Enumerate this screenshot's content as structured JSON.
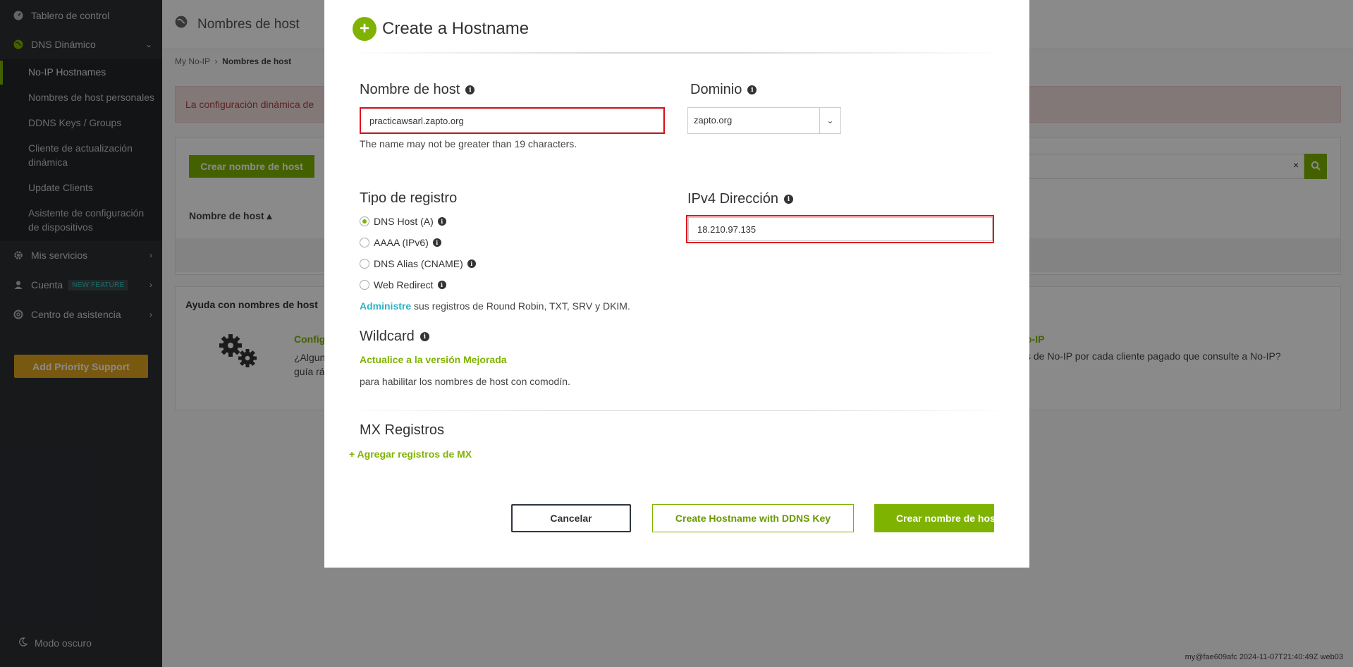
{
  "sidebar": {
    "dashboard": "Tablero de control",
    "dynamic_dns": "DNS Dinámico",
    "sub_items": [
      "No-IP Hostnames",
      "Nombres de host personales",
      "DDNS Keys / Groups",
      "Cliente de actualización",
      "dinámica",
      "Update Clients",
      "Asistente de configuración",
      "de dispositivos"
    ],
    "my_services": "Mis servicios",
    "account": "Cuenta",
    "new_feature_badge": "NEW FEATURE",
    "help_center": "Centro de asistencia",
    "priority_support": "Add Priority Support",
    "dark_mode": "Modo oscuro"
  },
  "background_page": {
    "title": "Nombres de host",
    "breadcrumb_root": "My No-IP",
    "breadcrumb_current": "Nombres de host",
    "alert_text": "La configuración dinámica de",
    "create_button": "Crear nombre de host",
    "search_clear": "×",
    "column_hostname": "Nombre de host ▴",
    "help_title": "Ayuda con nombres de host",
    "help_link_left": "Config",
    "help_text_left_1": "¿Algun",
    "help_text_left_2": "guía rá",
    "help_link_right": "o-IP",
    "help_text_right": "s de No-IP por cada cliente pagado que consulte a No-IP?",
    "build_info": "my@fae609afc 2024-11-07T21:40:49Z web03"
  },
  "modal": {
    "title": "Create a Hostname",
    "hostname_label": "Nombre de host",
    "hostname_value": "practicawsarl.zapto.org",
    "hostname_hint": "The name may not be greater than 19 characters.",
    "domain_label": "Dominio",
    "domain_value": "zapto.org",
    "record_type_label": "Tipo de registro",
    "record_types": [
      "DNS Host (A)",
      "AAAA (IPv6)",
      "DNS Alias (CNAME)",
      "Web Redirect"
    ],
    "selected_record_type": "DNS Host (A)",
    "manage_link": "Administre",
    "manage_text": " sus registros de Round Robin, TXT, SRV y DKIM.",
    "ipv4_label": "IPv4 Dirección",
    "ipv4_value": "18.210.97.135",
    "wildcard_label": "Wildcard",
    "upgrade_link": "Actualice a la versión Mejorada",
    "wildcard_text": "para habilitar los nombres de host con comodín.",
    "mx_label": "MX Registros",
    "add_mx": "+ Agregar registros de MX",
    "cancel_button": "Cancelar",
    "ddns_button": "Create Hostname with DDNS Key",
    "create_button": "Crear nombre de host"
  },
  "colors": {
    "accent_green": "#7fb301",
    "highlight_red": "#e0141c",
    "sidebar_bg": "#2d2f33",
    "priority_orange": "#e0a31d"
  }
}
